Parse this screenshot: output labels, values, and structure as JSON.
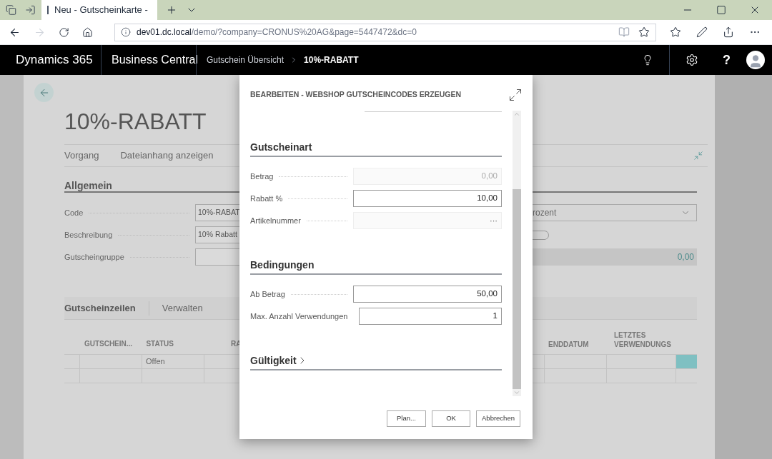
{
  "browser": {
    "tab_title": "Neu - Gutscheinkarte -",
    "url_host": "dev01.dc.local",
    "url_path": "/demo/?company=CRONUS%20AG&page=5447472&dc=0"
  },
  "app_bar": {
    "product": "Dynamics 365",
    "app": "Business Central",
    "breadcrumb": [
      "Gutschein Übersicht",
      "10%-RABATT"
    ],
    "help": "?"
  },
  "page": {
    "title": "10%-RABATT",
    "actions": [
      "Vorgang",
      "Dateianhang anzeigen"
    ],
    "general": {
      "heading": "Allgemein",
      "fields": [
        {
          "label": "Code",
          "value": "10%-RABAT"
        },
        {
          "label": "Beschreibung",
          "value": "10% Rabatt"
        },
        {
          "label": "Gutscheingruppe"
        }
      ],
      "select_value": "rozent",
      "toggle_on": false,
      "amount": "0,00"
    },
    "lines": {
      "tabs": [
        "Gutscheinzeilen",
        "Verwalten"
      ],
      "columns_left": [
        "GUTSCHEIN...",
        "STATUS",
        "RA"
      ],
      "columns_right": [
        "ENDDATUM",
        "LETZTES VERWENDUNGS"
      ],
      "rows": [
        {
          "status": "Offen",
          "selected": true
        },
        {
          "selected": false
        }
      ]
    }
  },
  "dialog": {
    "title": "BEARBEITEN - WEBSHOP GUTSCHEINCODES ERZEUGEN",
    "sections": [
      {
        "heading": "Gutscheinart",
        "expanded": true,
        "fields": [
          {
            "label": "Betrag",
            "value": "0,00",
            "disabled": true
          },
          {
            "label": "Rabatt %",
            "value": "10,00",
            "disabled": false
          },
          {
            "label": "Artikelnummer",
            "lookup": "···",
            "disabled": true
          }
        ]
      },
      {
        "heading": "Bedingungen",
        "expanded": true,
        "fields": [
          {
            "label": "Ab Betrag",
            "value": "50,00",
            "disabled": false
          },
          {
            "label": "Max. Anzahl Verwendungen",
            "value": "1",
            "disabled": false
          }
        ]
      },
      {
        "heading": "Gültigkeit",
        "expanded": false
      }
    ],
    "buttons": [
      "Plan...",
      "OK",
      "Abbrechen"
    ]
  }
}
